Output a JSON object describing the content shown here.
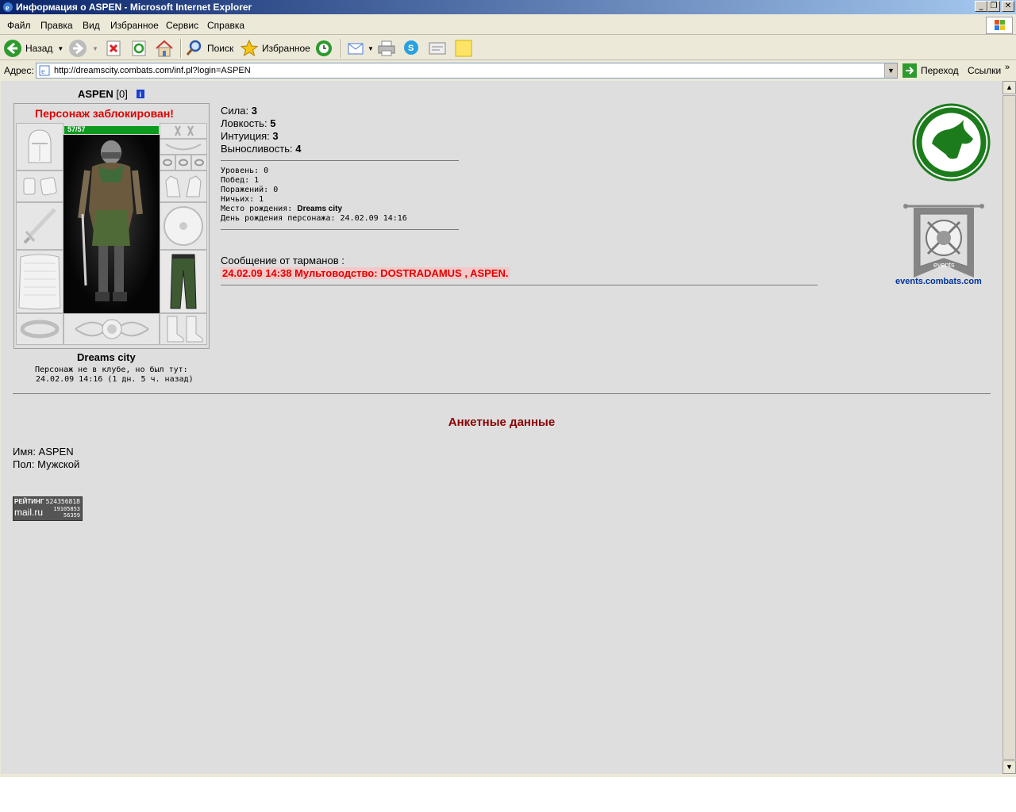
{
  "window": {
    "title": "Информация о ASPEN - Microsoft Internet Explorer"
  },
  "menu": [
    "Файл",
    "Правка",
    "Вид",
    "Избранное",
    "Сервис",
    "Справка"
  ],
  "toolbar": {
    "back_label": "Назад",
    "search_label": "Поиск",
    "favorites_label": "Избранное"
  },
  "address": {
    "label": "Адрес:",
    "url": "http://dreamscity.combats.com/inf.pl?login=ASPEN",
    "go_label": "Переход",
    "links_label": "Ссылки"
  },
  "character": {
    "name": "ASPEN",
    "level_tag": "[0]",
    "blocked_text": "Персонаж заблокирован!",
    "hp_text": "57/57",
    "hp_fraction": 1.0,
    "city": "Dreams city",
    "club_note_line1": "Персонаж не в клубе, но был тут:",
    "club_note_line2": "24.02.09 14:16 (1 дн. 5 ч. назад)"
  },
  "stats": [
    {
      "label": "Сила:",
      "value": "3"
    },
    {
      "label": "Ловкость:",
      "value": "5"
    },
    {
      "label": "Интуиция:",
      "value": "3"
    },
    {
      "label": "Выносливость:",
      "value": "4"
    }
  ],
  "info": {
    "level": "Уровень: 0",
    "wins": "Побед: 1",
    "losses": "Поражений: 0",
    "draws": "Ничьих: 1",
    "birthplace_label": "Место рождения:",
    "birthplace_value": "Dreams city",
    "birthday": "День рождения персонажа: 24.02.09 14:16"
  },
  "message": {
    "header": "Сообщение от тарманов :",
    "text": "24.02.09 14:38 Мультоводство: DOSTRADAMUS , ASPEN."
  },
  "events": {
    "banner_text": "events",
    "link": "events.combats.com"
  },
  "profile": {
    "heading": "Анкетные данные",
    "name_line": "Имя: ASPEN",
    "gender_line": "Пол: Мужской"
  },
  "counter": {
    "label": "РЕЙТИНГ",
    "num1": "524356818",
    "num2": "19105853",
    "num3": "56359",
    "brand": "mail.ru"
  },
  "colors": {
    "blocked_red": "#e00000",
    "heading_maroon": "#8b0000",
    "events_link": "#003399",
    "hp_green": "#0e9a1e",
    "message_bg": "#f4c8c8"
  }
}
